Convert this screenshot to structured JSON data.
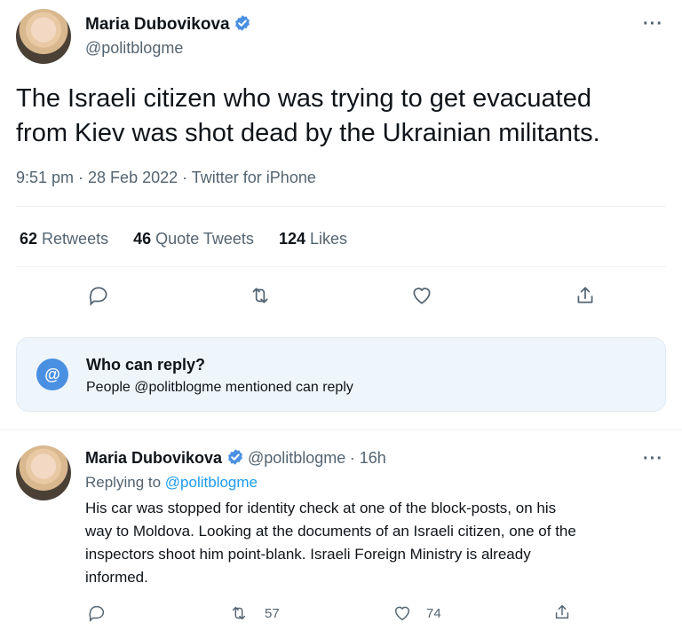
{
  "main_tweet": {
    "author_name": "Maria Dubovikova",
    "author_handle": "@politblogme",
    "more_label": "···",
    "text_line1": "The Israeli citizen who was trying to get evacuated",
    "text_line2": "from Kiev was shot dead by the Ukrainian militants.",
    "meta": "9:51 pm · 28 Feb 2022 · Twitter for iPhone",
    "stats": {
      "retweets_count": "62",
      "retweets_label": "Retweets",
      "quotes_count": "46",
      "quotes_label": "Quote Tweets",
      "likes_count": "124",
      "likes_label": "Likes"
    }
  },
  "who_can_reply": {
    "icon_glyph": "@",
    "title": "Who can reply?",
    "subtitle": "People @politblogme mentioned can reply"
  },
  "reply": {
    "author_name": "Maria Dubovikova",
    "author_handle": "@politblogme",
    "time": "· 16h",
    "more_label": "···",
    "replying_prefix": "Replying to",
    "replying_handle": "@politblogme",
    "text_lines": [
      "His car was stopped for identity check at one of the block-posts, on his",
      "way to Moldova. Looking at the documents of an Israeli citizen, one of the",
      "inspectors shoot him point-blank. Israeli Foreign Ministry is already",
      "informed."
    ],
    "retweet_count": "57",
    "like_count": "74"
  },
  "colors": {
    "accent": "#1d9bf0",
    "verified": "#4a90e2",
    "secondary_text": "#536471"
  }
}
